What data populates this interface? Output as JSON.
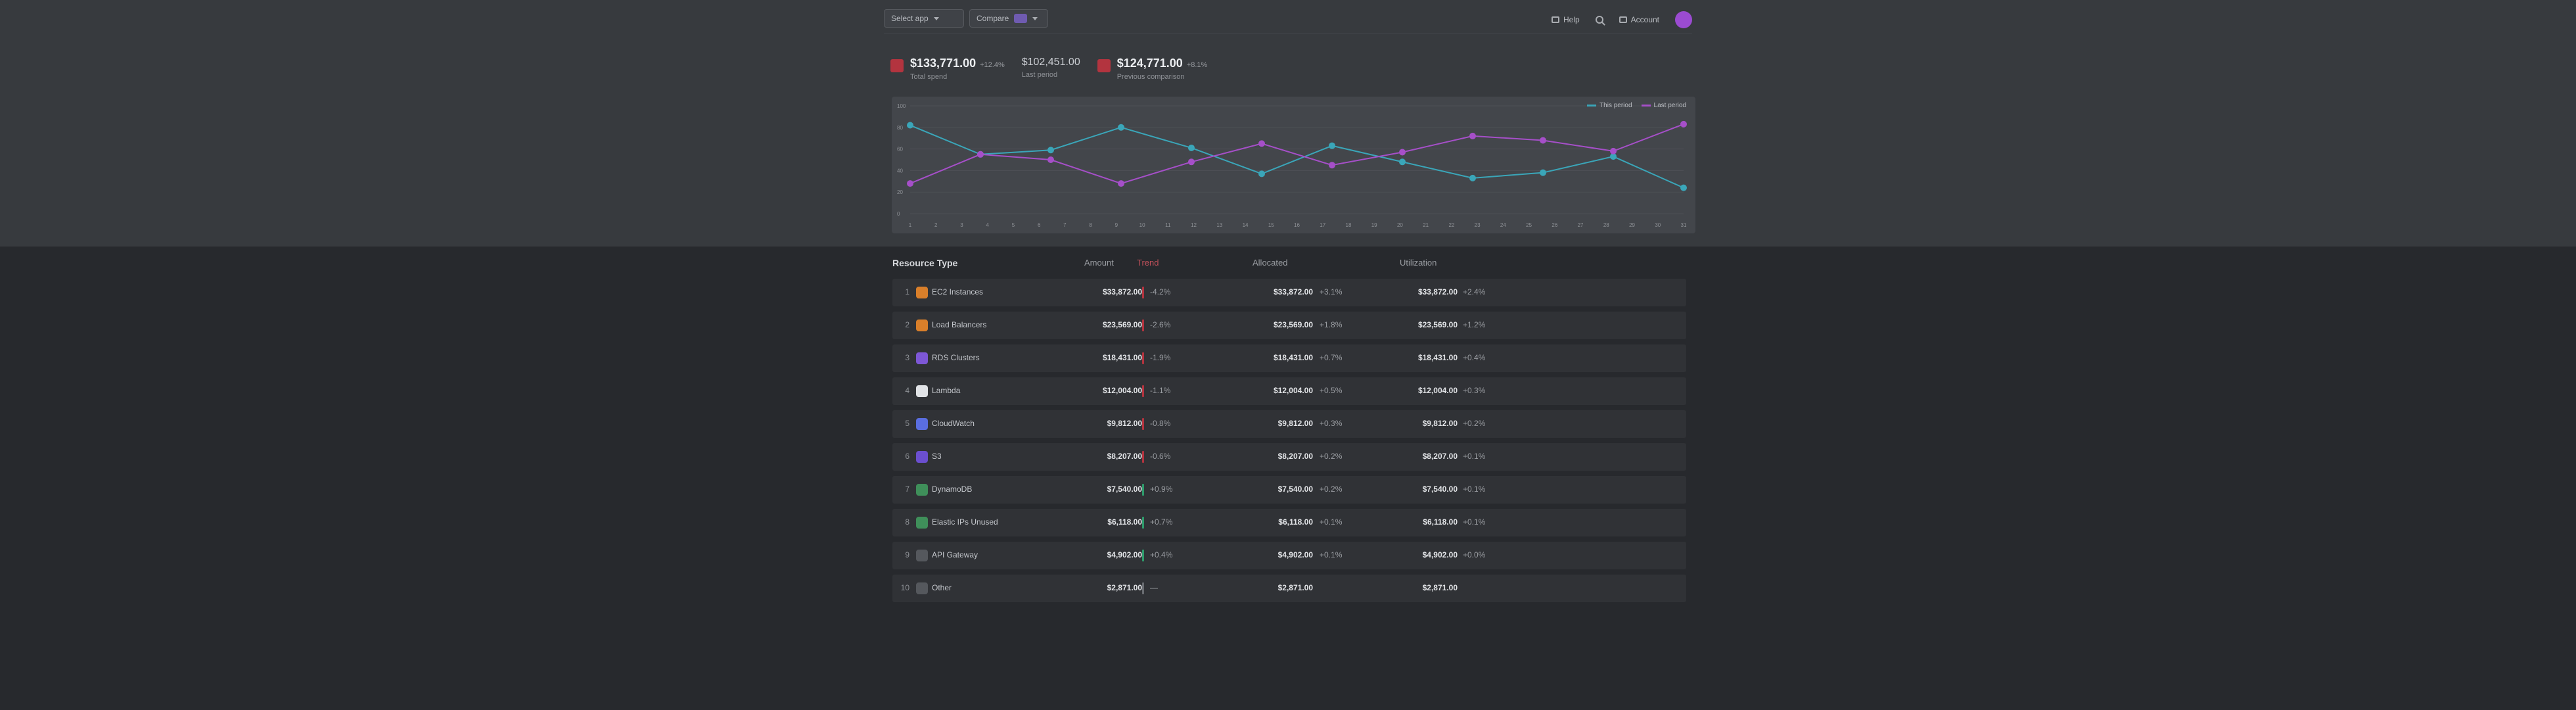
{
  "header": {
    "select_one_label": "Select app",
    "select_two_label": "Compare",
    "help_label": "Help",
    "account_label": "Account"
  },
  "summary": [
    {
      "value": "$133,771.00",
      "delta": "+12.4%",
      "label": "Total spend"
    },
    {
      "value": "$102,451.00",
      "label": "Last period"
    },
    {
      "value": "$124,771.00",
      "delta": "+8.1%",
      "label": "Previous comparison"
    }
  ],
  "chart_data": {
    "type": "line",
    "x": [
      "1",
      "2",
      "3",
      "4",
      "5",
      "6",
      "7",
      "8",
      "9",
      "10",
      "11",
      "12",
      "13",
      "14",
      "15",
      "16",
      "17",
      "18",
      "19",
      "20",
      "21",
      "22",
      "23",
      "24",
      "25",
      "26",
      "27",
      "28",
      "29",
      "30",
      "31"
    ],
    "ylim": [
      0,
      100
    ],
    "yticks": [
      "100",
      "80",
      "60",
      "40",
      "20",
      "0"
    ],
    "legend": [
      "This period",
      "Last period"
    ],
    "legend_position": "top-right",
    "colors": {
      "series_a": "#3aa6b9",
      "series_b": "#a64fc9"
    },
    "series": [
      {
        "name": "This period",
        "points": [
          [
            1,
            82
          ],
          [
            5,
            55
          ],
          [
            9,
            59
          ],
          [
            13,
            80
          ],
          [
            17,
            61
          ],
          [
            21,
            37
          ],
          [
            25,
            63
          ],
          [
            29,
            48
          ],
          [
            33,
            33
          ],
          [
            37,
            38
          ],
          [
            41,
            53
          ],
          [
            45,
            24
          ]
        ]
      },
      {
        "name": "Last period",
        "points": [
          [
            1,
            28
          ],
          [
            5,
            55
          ],
          [
            9,
            50
          ],
          [
            13,
            28
          ],
          [
            17,
            48
          ],
          [
            21,
            65
          ],
          [
            25,
            45
          ],
          [
            29,
            57
          ],
          [
            33,
            72
          ],
          [
            37,
            68
          ],
          [
            41,
            58
          ],
          [
            45,
            83
          ]
        ]
      }
    ]
  },
  "table": {
    "headers": [
      "Resource Type",
      "Amount",
      "Trend",
      "Allocated",
      "Utilization"
    ],
    "rows": [
      {
        "rank": "1",
        "name": "EC2 Instances",
        "logo": "#d97f2a",
        "v1": "$33,872.00",
        "trend": "down",
        "ch": "-4.2%",
        "v2": "$33,872.00",
        "ch2": "+3.1%",
        "v3": "$33,872.00",
        "ch3": "+2.4%"
      },
      {
        "rank": "2",
        "name": "Load Balancers",
        "logo": "#d97f2a",
        "v1": "$23,569.00",
        "trend": "down",
        "ch": "-2.6%",
        "v2": "$23,569.00",
        "ch2": "+1.8%",
        "v3": "$23,569.00",
        "ch3": "+1.2%"
      },
      {
        "rank": "3",
        "name": "RDS Clusters",
        "logo": "#7d57d6",
        "v1": "$18,431.00",
        "trend": "down",
        "ch": "-1.9%",
        "v2": "$18,431.00",
        "ch2": "+0.7%",
        "v3": "$18,431.00",
        "ch3": "+0.4%"
      },
      {
        "rank": "4",
        "name": "Lambda",
        "logo": "#e1e3e6",
        "v1": "$12,004.00",
        "trend": "down",
        "ch": "-1.1%",
        "v2": "$12,004.00",
        "ch2": "+0.5%",
        "v3": "$12,004.00",
        "ch3": "+0.3%"
      },
      {
        "rank": "5",
        "name": "CloudWatch",
        "logo": "#5a6ee0",
        "v1": "$9,812.00",
        "trend": "down",
        "ch": "-0.8%",
        "v2": "$9,812.00",
        "ch2": "+0.3%",
        "v3": "$9,812.00",
        "ch3": "+0.2%"
      },
      {
        "rank": "6",
        "name": "S3",
        "logo": "#6b4fd0",
        "v1": "$8,207.00",
        "trend": "down",
        "ch": "-0.6%",
        "v2": "$8,207.00",
        "ch2": "+0.2%",
        "v3": "$8,207.00",
        "ch3": "+0.1%"
      },
      {
        "rank": "7",
        "name": "DynamoDB",
        "logo": "#3f8f5a",
        "v1": "$7,540.00",
        "trend": "up",
        "ch": "+0.9%",
        "v2": "$7,540.00",
        "ch2": "+0.2%",
        "v3": "$7,540.00",
        "ch3": "+0.1%"
      },
      {
        "rank": "8",
        "name": "Elastic IPs Unused",
        "logo": "#3f8f5a",
        "v1": "$6,118.00",
        "trend": "up",
        "ch": "+0.7%",
        "v2": "$6,118.00",
        "ch2": "+0.1%",
        "v3": "$6,118.00",
        "ch3": "+0.1%"
      },
      {
        "rank": "9",
        "name": "API Gateway",
        "logo": "#55585d",
        "v1": "$4,902.00",
        "trend": "up",
        "ch": "+0.4%",
        "v2": "$4,902.00",
        "ch2": "+0.1%",
        "v3": "$4,902.00",
        "ch3": "+0.0%"
      },
      {
        "rank": "10",
        "name": "Other",
        "logo": "#55585d",
        "v1": "$2,871.00",
        "trend": "flat",
        "ch": "—",
        "v2": "$2,871.00",
        "ch2": "",
        "v3": "$2,871.00",
        "ch3": ""
      }
    ]
  },
  "colors": {
    "up": "#2e9a6b",
    "down": "#b3343f",
    "flat": "#6a6d72",
    "accent": "#9b4bd1"
  }
}
